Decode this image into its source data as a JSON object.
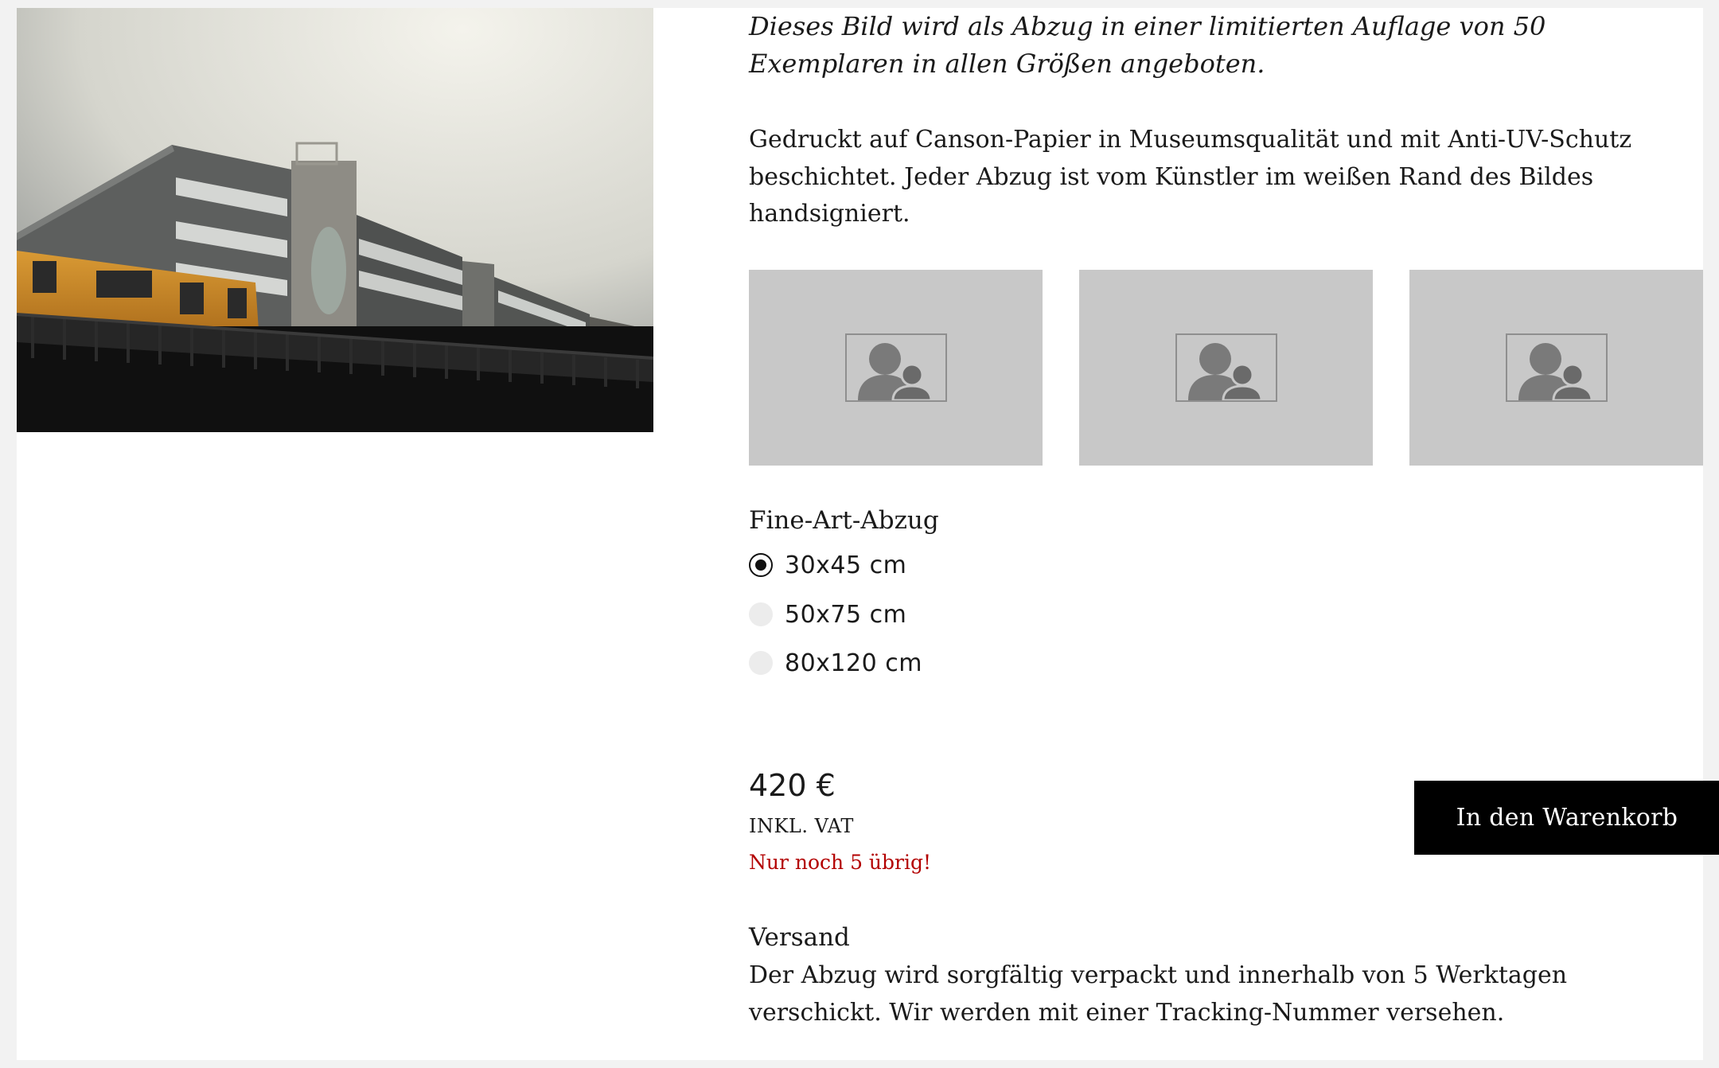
{
  "product": {
    "intro": "Dieses Bild wird als Abzug in einer limitierten Auflage von 50 Exemplaren in allen Größen angeboten.",
    "description": "Gedruckt auf Canson-Papier in Museumsqualität und mit Anti-UV-Schutz beschichtet. Jeder Abzug ist vom Künstler im weißen Rand des Bildes handsigniert."
  },
  "thumbnails": [
    {
      "icon": "image-placeholder-icon"
    },
    {
      "icon": "image-placeholder-icon"
    },
    {
      "icon": "image-placeholder-icon"
    }
  ],
  "options": {
    "title": "Fine-Art-Abzug",
    "items": [
      {
        "label": "30x45 cm",
        "selected": true
      },
      {
        "label": "50x75 cm",
        "selected": false
      },
      {
        "label": "80x120 cm",
        "selected": false
      }
    ]
  },
  "pricing": {
    "price": "420 €",
    "vat": "INKL. VAT",
    "stock": "Nur noch 5 übrig!",
    "cart_button": "In den Warenkorb"
  },
  "shipping": {
    "title": "Versand",
    "text": "Der Abzug wird sorgfältig verpackt und innerhalb von 5 Werktagen verschickt. Wir werden mit einer Tracking-Nummer versehen."
  },
  "colors": {
    "page_bg": "#f2f2f2",
    "accent_red": "#b30000",
    "button_bg": "#000000",
    "thumb_bg": "#c8c8c8"
  }
}
